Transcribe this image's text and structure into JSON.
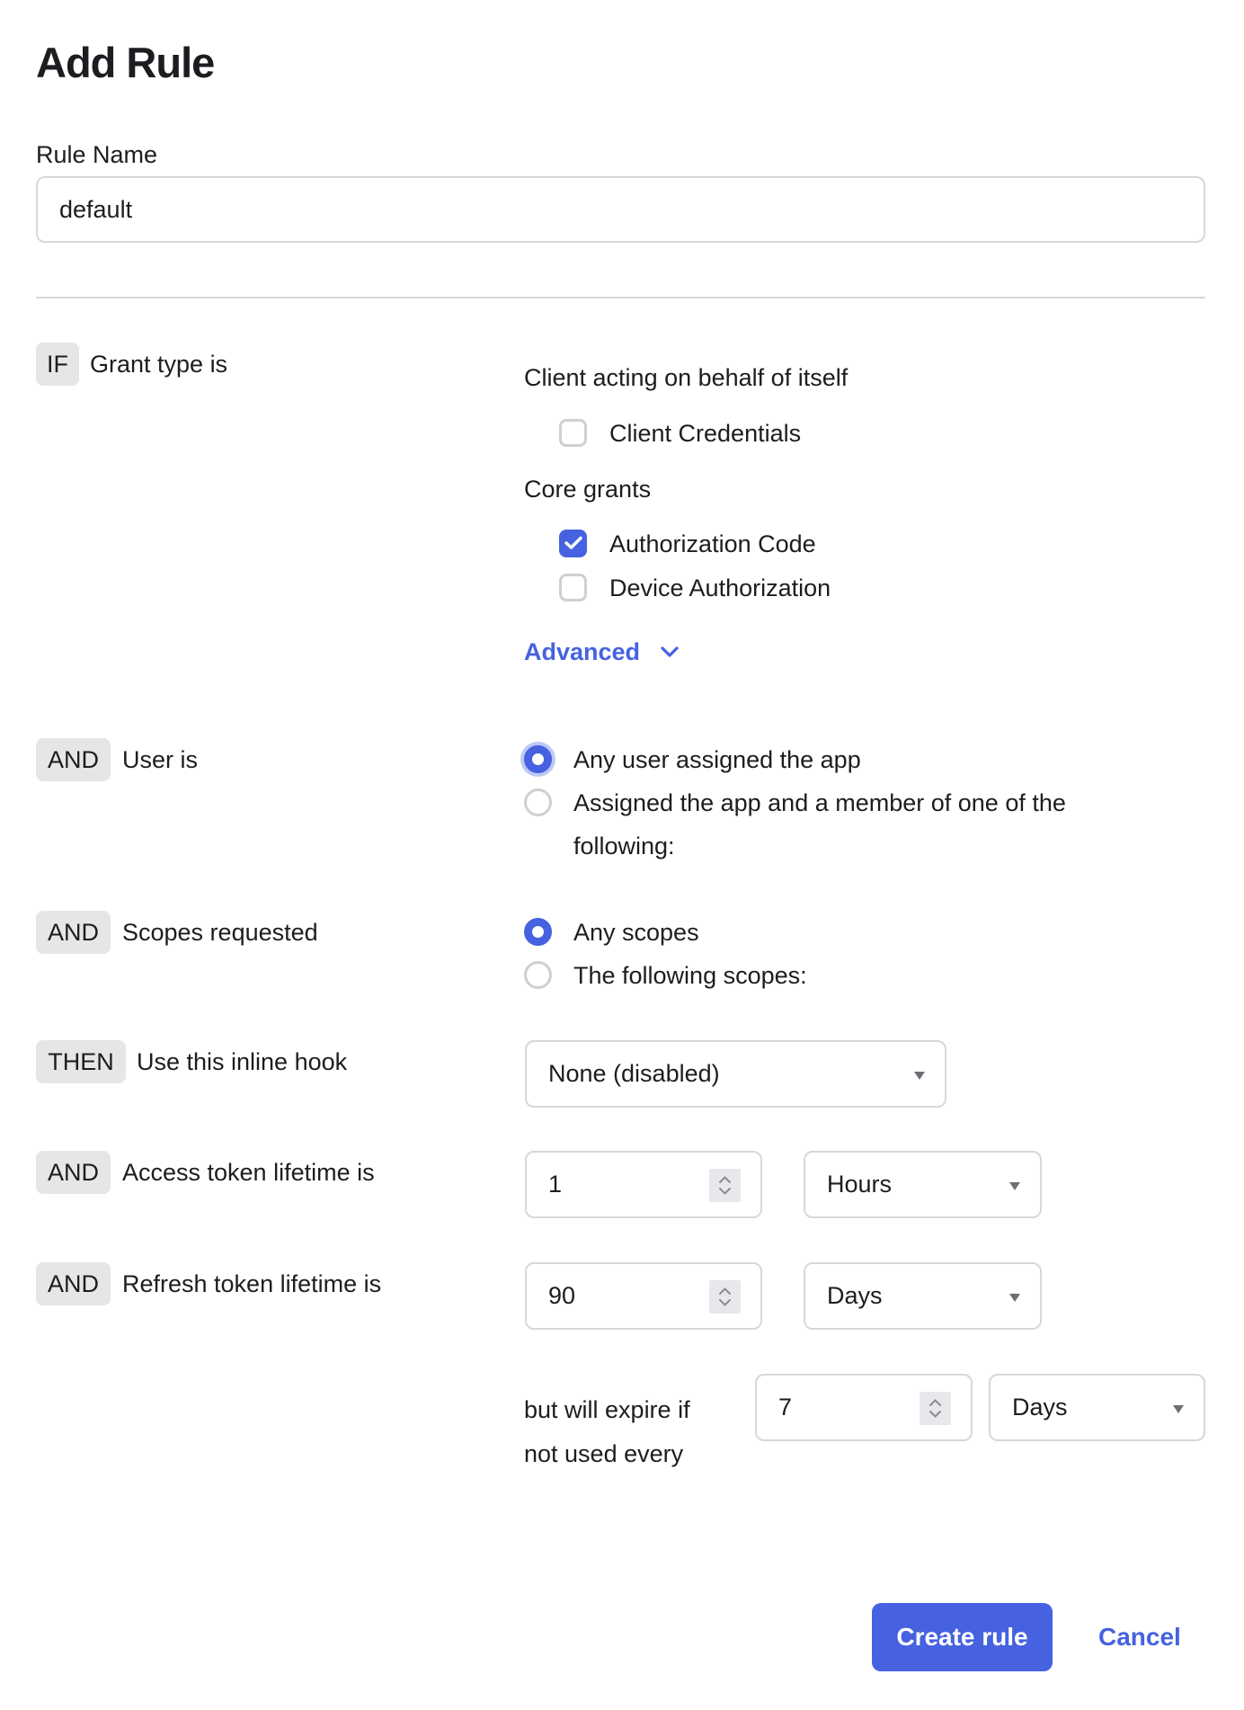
{
  "dialog": {
    "title": "Add Rule"
  },
  "rule_name": {
    "label": "Rule Name",
    "value": "default"
  },
  "grant_type": {
    "badge": "IF",
    "label": "Grant type is",
    "group_client": "Client acting on behalf of itself",
    "client_credentials": {
      "label": "Client Credentials",
      "checked": false
    },
    "group_core": "Core grants",
    "authorization_code": {
      "label": "Authorization Code",
      "checked": true
    },
    "device_authorization": {
      "label": "Device Authorization",
      "checked": false
    },
    "advanced_label": "Advanced",
    "advanced_icon": "chevron-down-icon"
  },
  "user": {
    "badge": "AND",
    "label": "User is",
    "options": [
      {
        "label": "Any user assigned the app",
        "selected": true
      },
      {
        "label_line1": "Assigned the app and a member of one of the",
        "label_line2": "following:",
        "selected": false
      }
    ]
  },
  "scopes": {
    "badge": "AND",
    "label": "Scopes requested",
    "options": [
      {
        "label": "Any scopes",
        "selected": true
      },
      {
        "label": "The following scopes:",
        "selected": false
      }
    ]
  },
  "inline_hook": {
    "badge": "THEN",
    "label": "Use this inline hook",
    "selected": "None (disabled)"
  },
  "access_token": {
    "badge": "AND",
    "label": "Access token lifetime is",
    "value": "1",
    "unit": "Hours"
  },
  "refresh_token": {
    "badge": "AND",
    "label": "Refresh token lifetime is",
    "value": "90",
    "unit": "Days",
    "expire_line1": "but will expire if",
    "expire_line2": "not used every",
    "expire_value": "7",
    "expire_unit": "Days"
  },
  "actions": {
    "create_label": "Create rule",
    "cancel_label": "Cancel"
  },
  "colors": {
    "accent": "#4662e0",
    "badge_bg": "#e6e6e6",
    "border": "#d7d7dc",
    "text": "#1d1d21"
  }
}
